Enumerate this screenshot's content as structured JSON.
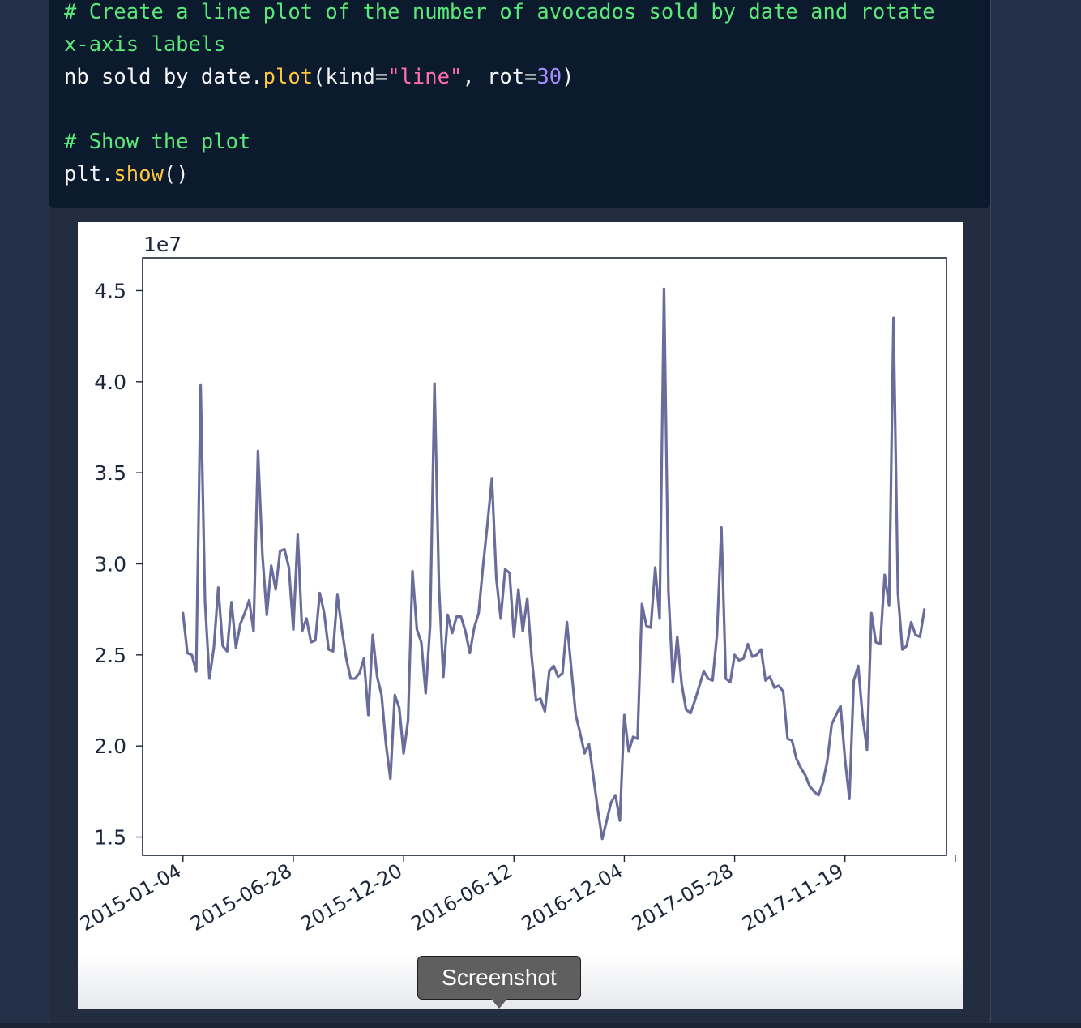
{
  "code": {
    "comment1": "# Create a line plot of the number of avocados sold by date and rotate",
    "comment1b": "x-axis labels",
    "line_obj": "nb_sold_by_date.",
    "line_func": "plot",
    "line_open": "(kind=",
    "line_str": "\"line\"",
    "line_mid": ", rot=",
    "line_num": "30",
    "line_close": ")",
    "comment2": "# Show the plot",
    "show_obj": "plt.",
    "show_func": "show",
    "show_close": "()"
  },
  "tooltip": {
    "label": "Screenshot"
  },
  "chart_data": {
    "type": "line",
    "title": "",
    "xlabel": "",
    "ylabel": "",
    "offset_text": "1e7",
    "color": "#6a6d9b",
    "ylim": [
      14000000,
      46800000
    ],
    "yticks": [
      15000000,
      20000000,
      25000000,
      30000000,
      35000000,
      40000000,
      45000000
    ],
    "ytick_labels": [
      "1.5",
      "2.0",
      "2.5",
      "3.0",
      "3.5",
      "4.0",
      "4.5"
    ],
    "xlim": [
      "2014-11-01",
      "2018-04-29"
    ],
    "xticks": [
      "2015-01-04",
      "2015-06-28",
      "2015-12-20",
      "2016-06-12",
      "2016-12-04",
      "2017-05-28",
      "2017-11-19",
      "2018-05-13"
    ],
    "xtick_labels": [
      "2015-01-04",
      "2015-06-28",
      "2015-12-20",
      "2016-06-12",
      "2016-12-04",
      "2017-05-28",
      "2017-11-19",
      ""
    ],
    "x_start": "2015-01-04",
    "x_step_days": 7,
    "values": [
      27300000,
      25100000,
      25000000,
      24100000,
      39800000,
      27900000,
      23700000,
      25400000,
      28700000,
      25500000,
      25200000,
      27900000,
      25400000,
      26700000,
      27300000,
      28000000,
      26300000,
      36200000,
      30500000,
      27200000,
      29900000,
      28600000,
      30700000,
      30800000,
      29800000,
      26400000,
      31600000,
      26300000,
      27000000,
      25700000,
      25800000,
      28400000,
      27300000,
      25300000,
      25200000,
      28300000,
      26400000,
      24800000,
      23700000,
      23700000,
      24000000,
      24800000,
      21700000,
      26100000,
      23800000,
      22800000,
      20100000,
      18200000,
      22800000,
      22100000,
      19600000,
      21400000,
      29600000,
      26400000,
      25700000,
      22900000,
      26600000,
      39900000,
      28800000,
      23800000,
      27200000,
      26200000,
      27100000,
      27100000,
      26300000,
      25100000,
      26500000,
      27300000,
      29900000,
      32200000,
      34700000,
      29200000,
      27000000,
      29700000,
      29500000,
      26000000,
      28600000,
      26300000,
      28100000,
      24900000,
      22500000,
      22600000,
      21900000,
      24100000,
      24400000,
      23800000,
      24000000,
      26800000,
      24200000,
      21700000,
      20700000,
      19600000,
      20100000,
      18300000,
      16500000,
      14900000,
      15900000,
      16900000,
      17300000,
      15900000,
      21700000,
      19700000,
      20500000,
      20400000,
      27800000,
      26600000,
      26500000,
      29800000,
      27000000,
      45100000,
      28500000,
      23500000,
      26000000,
      23400000,
      22000000,
      21800000,
      22500000,
      23300000,
      24100000,
      23700000,
      23600000,
      26100000,
      32000000,
      23700000,
      23500000,
      25000000,
      24700000,
      24800000,
      25600000,
      24900000,
      25000000,
      25300000,
      23600000,
      23800000,
      23200000,
      23300000,
      23000000,
      20400000,
      20300000,
      19300000,
      18800000,
      18400000,
      17800000,
      17500000,
      17300000,
      18000000,
      19200000,
      21200000,
      21700000,
      22200000,
      19300000,
      17100000,
      23600000,
      24400000,
      21600000,
      19800000,
      27300000,
      25700000,
      25600000,
      29400000,
      27700000,
      43500000,
      28400000,
      25300000,
      25500000,
      26800000,
      26100000,
      26000000,
      27500000
    ]
  }
}
